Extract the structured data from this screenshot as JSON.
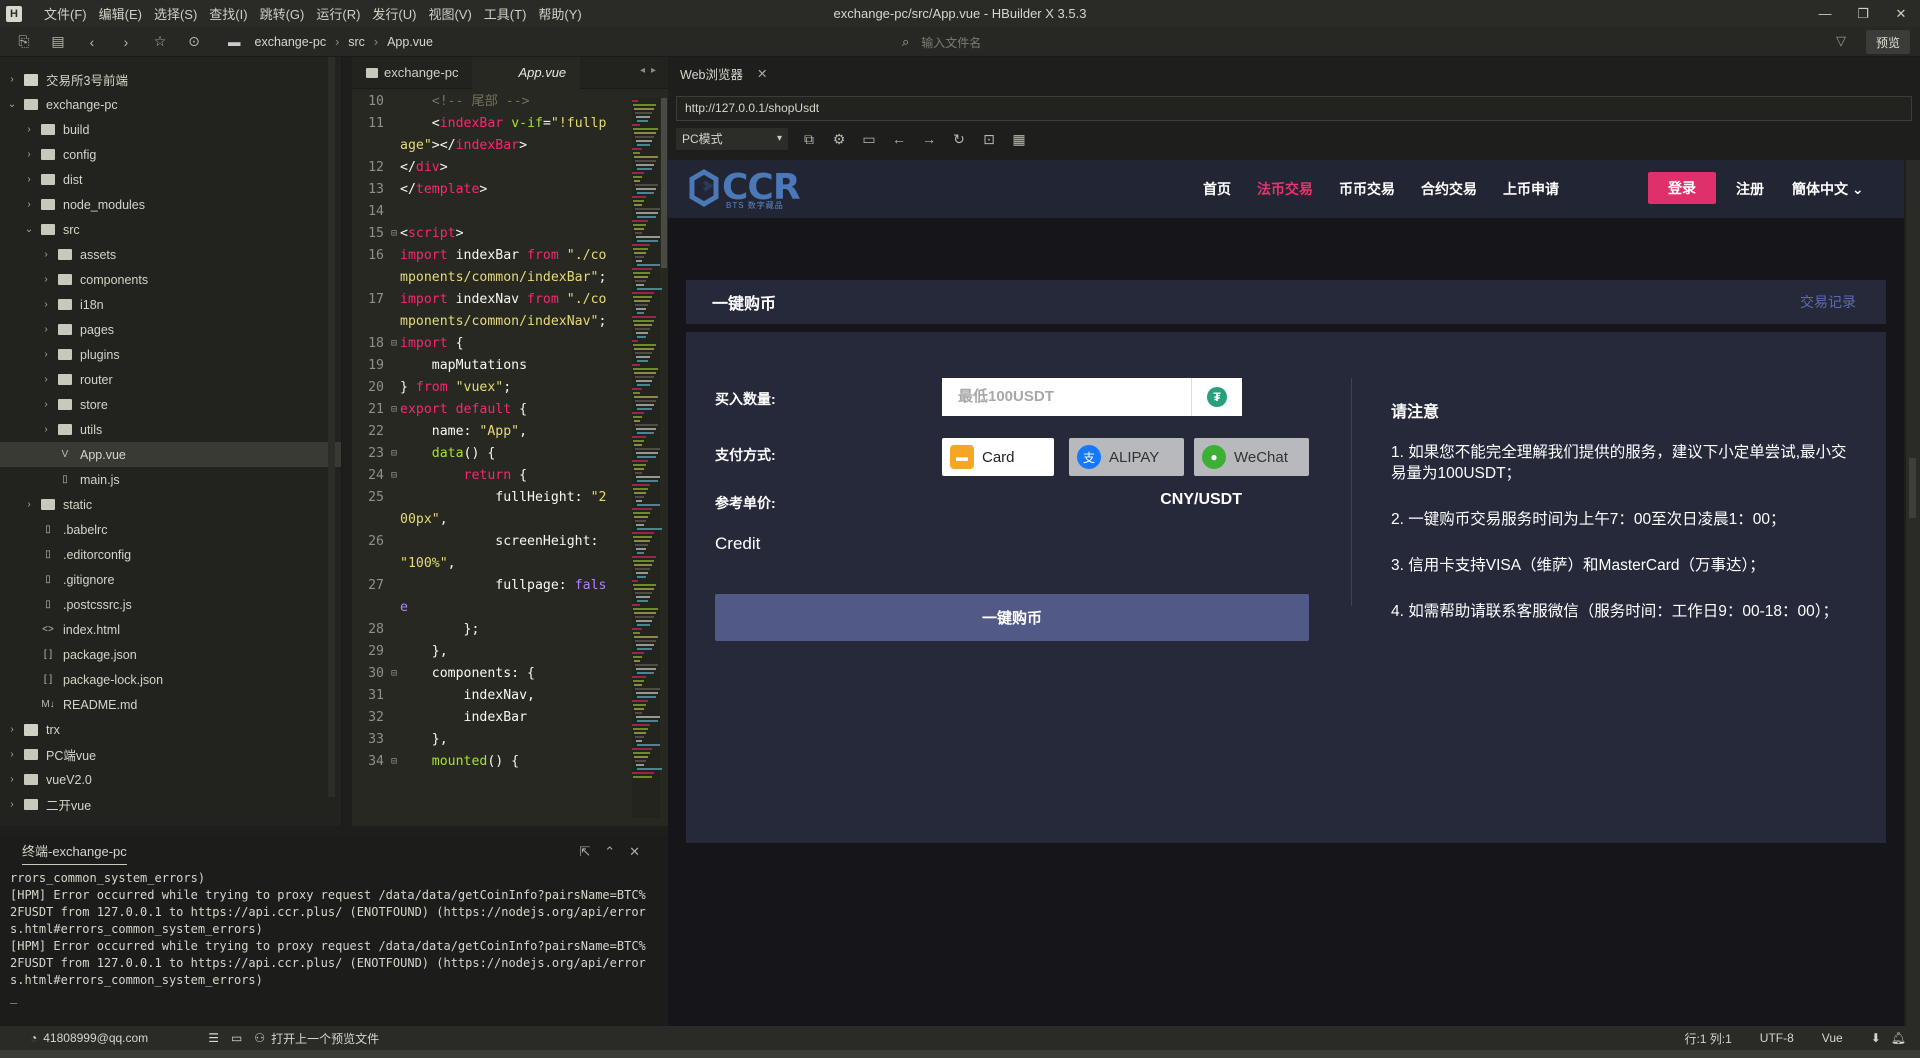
{
  "titlebar": {
    "menu": [
      "文件(F)",
      "编辑(E)",
      "选择(S)",
      "查找(I)",
      "跳转(G)",
      "运行(R)",
      "发行(U)",
      "视图(V)",
      "工具(T)",
      "帮助(Y)"
    ],
    "title": "exchange-pc/src/App.vue - HBuilder X 3.5.3"
  },
  "toolbar": {
    "breadcrumb": [
      "exchange-pc",
      "src",
      "App.vue"
    ],
    "search_placeholder": "输入文件名",
    "preview": "预览"
  },
  "sidebar": {
    "items": [
      {
        "label": "交易所3号前端",
        "depth": 0,
        "kind": "project",
        "open": false
      },
      {
        "label": "exchange-pc",
        "depth": 0,
        "kind": "folder",
        "open": true
      },
      {
        "label": "build",
        "depth": 1,
        "kind": "folder",
        "open": false
      },
      {
        "label": "config",
        "depth": 1,
        "kind": "folder",
        "open": false
      },
      {
        "label": "dist",
        "depth": 1,
        "kind": "folder",
        "open": false
      },
      {
        "label": "node_modules",
        "depth": 1,
        "kind": "folder",
        "open": false
      },
      {
        "label": "src",
        "depth": 1,
        "kind": "folder",
        "open": true
      },
      {
        "label": "assets",
        "depth": 2,
        "kind": "folder",
        "open": false
      },
      {
        "label": "components",
        "depth": 2,
        "kind": "folder",
        "open": false
      },
      {
        "label": "i18n",
        "depth": 2,
        "kind": "folder",
        "open": false
      },
      {
        "label": "pages",
        "depth": 2,
        "kind": "folder",
        "open": false
      },
      {
        "label": "plugins",
        "depth": 2,
        "kind": "folder",
        "open": false
      },
      {
        "label": "router",
        "depth": 2,
        "kind": "folder",
        "open": false
      },
      {
        "label": "store",
        "depth": 2,
        "kind": "folder",
        "open": false
      },
      {
        "label": "utils",
        "depth": 2,
        "kind": "folder",
        "open": false
      },
      {
        "label": "App.vue",
        "depth": 2,
        "kind": "file",
        "icon": "V",
        "selected": true
      },
      {
        "label": "main.js",
        "depth": 2,
        "kind": "file",
        "icon": "▯"
      },
      {
        "label": "static",
        "depth": 1,
        "kind": "folder",
        "open": false
      },
      {
        "label": ".babelrc",
        "depth": 1,
        "kind": "file",
        "icon": "▯"
      },
      {
        "label": ".editorconfig",
        "depth": 1,
        "kind": "file",
        "icon": "▯"
      },
      {
        "label": ".gitignore",
        "depth": 1,
        "kind": "file",
        "icon": "▯"
      },
      {
        "label": ".postcssrc.js",
        "depth": 1,
        "kind": "file",
        "icon": "▯"
      },
      {
        "label": "index.html",
        "depth": 1,
        "kind": "file",
        "icon": "<>"
      },
      {
        "label": "package.json",
        "depth": 1,
        "kind": "file",
        "icon": "[ ]"
      },
      {
        "label": "package-lock.json",
        "depth": 1,
        "kind": "file",
        "icon": "[ ]"
      },
      {
        "label": "README.md",
        "depth": 1,
        "kind": "file",
        "icon": "M↓"
      },
      {
        "label": "trx",
        "depth": 0,
        "kind": "project",
        "open": false
      },
      {
        "label": "PC端vue",
        "depth": 0,
        "kind": "folder",
        "open": false
      },
      {
        "label": "vueV2.0",
        "depth": 0,
        "kind": "folder",
        "open": false
      },
      {
        "label": "二开vue",
        "depth": 0,
        "kind": "folder",
        "open": false
      }
    ]
  },
  "editor": {
    "tabs": [
      "exchange-pc",
      "App.vue"
    ],
    "lines": [
      {
        "n": "10",
        "f": "",
        "s": [
          [
            "c-cm",
            "    <!-- 尾部 -->"
          ]
        ]
      },
      {
        "n": "11",
        "f": "",
        "s": [
          [
            "c-pu",
            "    <"
          ],
          [
            "c-tg",
            "indexBar"
          ],
          [
            "c-at",
            " v-if"
          ],
          [
            "c-pu",
            "="
          ],
          [
            "c-st",
            "\"!fullpage\""
          ],
          [
            "c-pu",
            "></"
          ],
          [
            "c-tg",
            "indexBar"
          ],
          [
            "c-pu",
            ">"
          ]
        ]
      },
      {
        "n": "12",
        "f": "",
        "s": [
          [
            "c-pu",
            "</"
          ],
          [
            "c-tg",
            "div"
          ],
          [
            "c-pu",
            ">"
          ]
        ]
      },
      {
        "n": "13",
        "f": "",
        "s": [
          [
            "c-pu",
            "</"
          ],
          [
            "c-tg",
            "template"
          ],
          [
            "c-pu",
            ">"
          ]
        ]
      },
      {
        "n": "14",
        "f": "",
        "s": [
          [
            "c-pu",
            ""
          ]
        ]
      },
      {
        "n": "15",
        "f": "⊟",
        "s": [
          [
            "c-pu",
            "<"
          ],
          [
            "c-tg",
            "script"
          ],
          [
            "c-pu",
            ">"
          ]
        ]
      },
      {
        "n": "16",
        "f": "",
        "s": [
          [
            "c-kw",
            "import"
          ],
          [
            "c-pu",
            " indexBar "
          ],
          [
            "c-kw",
            "from"
          ],
          [
            "c-st",
            " \"./components/common/indexBar\""
          ],
          [
            "c-pu",
            ";"
          ]
        ]
      },
      {
        "n": "17",
        "f": "",
        "s": [
          [
            "c-kw",
            "import"
          ],
          [
            "c-pu",
            " indexNav "
          ],
          [
            "c-kw",
            "from"
          ],
          [
            "c-st",
            " \"./components/common/indexNav\""
          ],
          [
            "c-pu",
            ";"
          ]
        ]
      },
      {
        "n": "18",
        "f": "⊟",
        "s": [
          [
            "c-kw",
            "import"
          ],
          [
            "c-pu",
            " {"
          ]
        ]
      },
      {
        "n": "19",
        "f": "",
        "s": [
          [
            "c-pu",
            "    mapMutations"
          ]
        ]
      },
      {
        "n": "20",
        "f": "",
        "s": [
          [
            "c-pu",
            "} "
          ],
          [
            "c-kw",
            "from"
          ],
          [
            "c-st",
            " \"vuex\""
          ],
          [
            "c-pu",
            ";"
          ]
        ]
      },
      {
        "n": "21",
        "f": "⊟",
        "s": [
          [
            "c-kw",
            "export default"
          ],
          [
            "c-pu",
            " {"
          ]
        ]
      },
      {
        "n": "22",
        "f": "",
        "s": [
          [
            "c-pu",
            "    name: "
          ],
          [
            "c-st",
            "\"App\""
          ],
          [
            "c-pu",
            ","
          ]
        ]
      },
      {
        "n": "23",
        "f": "⊟",
        "s": [
          [
            "c-fn",
            "    data"
          ],
          [
            "c-pu",
            "() {"
          ]
        ]
      },
      {
        "n": "24",
        "f": "⊟",
        "s": [
          [
            "c-kw",
            "        return"
          ],
          [
            "c-pu",
            " {"
          ]
        ]
      },
      {
        "n": "25",
        "f": "",
        "s": [
          [
            "c-pu",
            "            fullHeight: "
          ],
          [
            "c-st",
            "\"200px\""
          ],
          [
            "c-pu",
            ","
          ]
        ]
      },
      {
        "n": "26",
        "f": "",
        "s": [
          [
            "c-pu",
            "            screenHeight: "
          ],
          [
            "c-st",
            "\"100%\""
          ],
          [
            "c-pu",
            ","
          ]
        ]
      },
      {
        "n": "27",
        "f": "",
        "s": [
          [
            "c-pu",
            "            fullpage: "
          ],
          [
            "c-bl",
            "false"
          ]
        ]
      },
      {
        "n": "28",
        "f": "",
        "s": [
          [
            "c-pu",
            "        };"
          ]
        ]
      },
      {
        "n": "29",
        "f": "",
        "s": [
          [
            "c-pu",
            "    },"
          ]
        ]
      },
      {
        "n": "30",
        "f": "⊟",
        "s": [
          [
            "c-pu",
            "    components: {"
          ]
        ]
      },
      {
        "n": "31",
        "f": "",
        "s": [
          [
            "c-pu",
            "        indexNav,"
          ]
        ]
      },
      {
        "n": "32",
        "f": "",
        "s": [
          [
            "c-pu",
            "        indexBar"
          ]
        ]
      },
      {
        "n": "33",
        "f": "",
        "s": [
          [
            "c-pu",
            "    },"
          ]
        ]
      },
      {
        "n": "34",
        "f": "⊟",
        "s": [
          [
            "c-fn",
            "    mounted"
          ],
          [
            "c-pu",
            "() {"
          ]
        ]
      }
    ]
  },
  "browser": {
    "tab": "Web浏览器",
    "url": "http://127.0.0.1/shopUsdt",
    "mode": "PC模式"
  },
  "site": {
    "logo": "CCR",
    "logo_sub": "BTS 数字藏品",
    "nav": [
      "首页",
      "法币交易",
      "币币交易",
      "合约交易",
      "上币申请"
    ],
    "nav_active_index": 1,
    "login": "登录",
    "register": "注册",
    "lang": "簡体中文",
    "accent": "#e0306b",
    "header_title": "一键购币",
    "header_link": "交易记录",
    "qty_label": "买入数量:",
    "qty_placeholder": "最低100USDT",
    "pay_label": "支付方式:",
    "pay_options": [
      "Card",
      "ALIPAY",
      "WeChat"
    ],
    "ref_label": "参考单价:",
    "ref_value": "CNY/USDT",
    "credit": "Credit",
    "buy_button": "一键购币",
    "notice_title": "请注意",
    "notices": [
      "1. 如果您不能完全理解我们提供的服务，建议下小定单尝试,最小交易量为100USDT；",
      "2. 一键购币交易服务时间为上午7：00至次日凌晨1：00；",
      "3. 信用卡支持VISA（维萨）和MasterCard（万事达）；",
      "4. 如需帮助请联系客服微信（服务时间：工作日9：00-18：00）；"
    ]
  },
  "terminal": {
    "tab": "终端-exchange-pc",
    "text": "rrors_common_system_errors)\n[HPM] Error occurred while trying to proxy request /data/data/getCoinInfo?pairsName=BTC%2FUSDT from 127.0.0.1 to https://api.ccr.plus/ (ENOTFOUND) (https://nodejs.org/api/errors.html#errors_common_system_errors)\n[HPM] Error occurred while trying to proxy request /data/data/getCoinInfo?pairsName=BTC%2FUSDT from 127.0.0.1 to https://api.ccr.plus/ (ENOTFOUND) (https://nodejs.org/api/errors.html#errors_common_system_errors)\n_"
  },
  "status": {
    "user": "41808999@qq.com",
    "hint": "打开上一个预览文件",
    "pos": "行:1  列:1",
    "encoding": "UTF-8",
    "lang": "Vue"
  }
}
